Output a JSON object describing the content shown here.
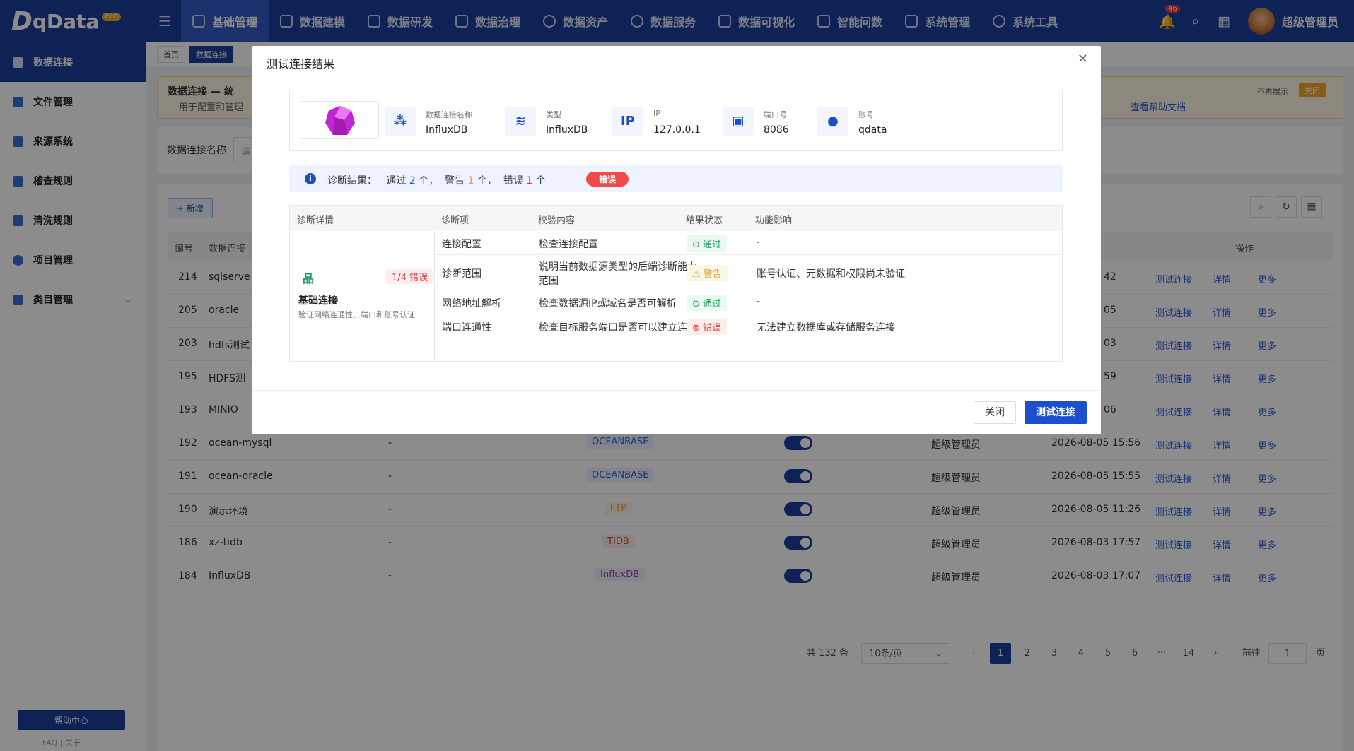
{
  "app": {
    "logo_mark": "D",
    "logo_text": "qData",
    "logo_badge": "PRO"
  },
  "topnav": [
    {
      "label": "基础管理"
    },
    {
      "label": "数据建模"
    },
    {
      "label": "数据研发"
    },
    {
      "label": "数据治理"
    },
    {
      "label": "数据资产"
    },
    {
      "label": "数据服务"
    },
    {
      "label": "数据可视化"
    },
    {
      "label": "智能问数"
    },
    {
      "label": "系统管理"
    },
    {
      "label": "系统工具"
    }
  ],
  "header": {
    "notification_count": "46",
    "username": "超级管理员"
  },
  "sidebar": {
    "items": [
      {
        "label": "数据连接"
      },
      {
        "label": "文件管理"
      },
      {
        "label": "来源系统"
      },
      {
        "label": "稽查规则"
      },
      {
        "label": "清洗规则"
      },
      {
        "label": "项目管理"
      },
      {
        "label": "类目管理"
      }
    ],
    "help_button": "帮助中心",
    "help_links": "FAQ  |  关于"
  },
  "page_tabs": [
    {
      "label": "首页"
    },
    {
      "label": "数据连接"
    }
  ],
  "notice": {
    "title": "数据连接 — 统",
    "subtitle": "用于配置和管理",
    "help_link": "查看帮助文档",
    "hide_label": "不再展示",
    "close_label": "关闭"
  },
  "filter": {
    "label": "数据连接名称",
    "placeholder": "请"
  },
  "table": {
    "add_label": "+ 新增",
    "headers": {
      "id": "编号",
      "name": "数据连接",
      "actions": "操作"
    },
    "rows": [
      {
        "id": "214",
        "name": "sqlserve",
        "desc": "",
        "type": "",
        "creator": "",
        "time": "42"
      },
      {
        "id": "205",
        "name": "oracle",
        "desc": "",
        "type": "",
        "creator": "",
        "time": "05"
      },
      {
        "id": "203",
        "name": "hdfs测试",
        "desc": "",
        "type": "",
        "creator": "",
        "time": "03"
      },
      {
        "id": "195",
        "name": "HDFS测",
        "desc": "",
        "type": "",
        "creator": "",
        "time": "59"
      },
      {
        "id": "193",
        "name": "MINIO",
        "desc": "",
        "type": "",
        "creator": "",
        "time": "06"
      },
      {
        "id": "192",
        "name": "ocean-mysql",
        "desc": "-",
        "type": "OCEANBASE",
        "creator": "超级管理员",
        "time": "2026-08-05 15:56"
      },
      {
        "id": "191",
        "name": "ocean-oracle",
        "desc": "-",
        "type": "OCEANBASE",
        "creator": "超级管理员",
        "time": "2026-08-05 15:55"
      },
      {
        "id": "190",
        "name": "演示环境",
        "desc": "-",
        "type": "FTP",
        "creator": "超级管理员",
        "time": "2026-08-05 11:26"
      },
      {
        "id": "186",
        "name": "xz-tidb",
        "desc": "-",
        "type": "TIDB",
        "creator": "超级管理员",
        "time": "2026-08-03 17:57"
      },
      {
        "id": "184",
        "name": "InfluxDB",
        "desc": "-",
        "type": "InfluxDB",
        "creator": "超级管理员",
        "time": "2026-08-03 17:07"
      }
    ],
    "action_labels": {
      "test": "测试连接",
      "detail": "详情",
      "more": "更多"
    }
  },
  "pager": {
    "total": "共 132 条",
    "page_size": "10条/页",
    "pages": [
      "1",
      "2",
      "3",
      "4",
      "5",
      "6",
      "···",
      "14"
    ],
    "current_page": "1",
    "goto_label": "前往",
    "goto_value": "1",
    "page_unit": "页"
  },
  "dialog": {
    "title": "测试连接结果",
    "info": [
      {
        "label": "数据连接名称",
        "value": "InfluxDB",
        "icon": "cubes-icon"
      },
      {
        "label": "类型",
        "value": "InfluxDB",
        "icon": "layers-icon"
      },
      {
        "label": "IP",
        "value": "127.0.0.1",
        "icon": "ip-icon"
      },
      {
        "label": "端口号",
        "value": "8086",
        "icon": "port-icon"
      },
      {
        "label": "账号",
        "value": "qdata",
        "icon": "user-icon"
      }
    ],
    "summary": {
      "label": "诊断结果：",
      "pass_label": "通过",
      "pass_count": "2",
      "pass_unit": "个，",
      "warn_label": "警告",
      "warn_count": "1",
      "warn_unit": "个，",
      "err_label": "错误",
      "err_count": "1",
      "err_unit": "个",
      "tag": "错误"
    },
    "diag_headers": {
      "detail": "诊断详情",
      "item": "诊断项",
      "check": "校验内容",
      "status": "结果状态",
      "impact": "功能影响"
    },
    "group": {
      "badge": "1/4 错误",
      "title": "基础连接",
      "subtitle": "验证网络连通性、端口和账号认证"
    },
    "rows": [
      {
        "item": "连接配置",
        "check": "检查连接配置",
        "check2": "",
        "status": "通过",
        "impact": "-"
      },
      {
        "item": "诊断范围",
        "check": "说明当前数据源类型的后端诊断能力",
        "check2": "范围",
        "status": "警告",
        "impact": "账号认证、元数据和权限尚未验证"
      },
      {
        "item": "网络地址解析",
        "check": "检查数据源IP或域名是否可解析",
        "check2": "",
        "status": "通过",
        "impact": "-"
      },
      {
        "item": "端口连通性",
        "check": "检查目标服务端口是否可以建立连接",
        "check2": "",
        "status": "错误",
        "impact": "无法建立数据库或存储服务连接"
      }
    ],
    "cancel_label": "关闭",
    "test_label": "测试连接"
  }
}
